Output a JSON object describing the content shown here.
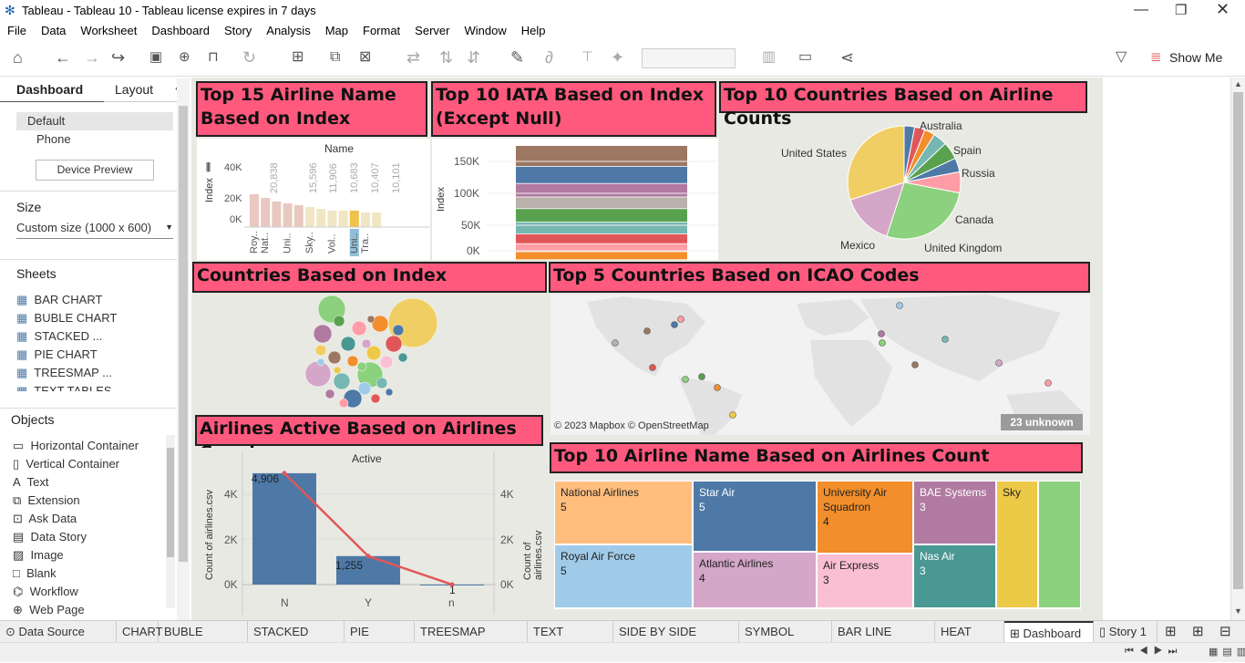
{
  "window": {
    "title": "Tableau - Tableau 10 - Tableau license expires in 7 days"
  },
  "menu": [
    "File",
    "Data",
    "Worksheet",
    "Dashboard",
    "Story",
    "Analysis",
    "Map",
    "Format",
    "Server",
    "Window",
    "Help"
  ],
  "toolbar": {
    "show_me": "Show Me"
  },
  "left": {
    "tab_dashboard": "Dashboard",
    "tab_layout": "Layout",
    "device_default": "Default",
    "device_phone": "Phone",
    "device_preview": "Device Preview",
    "size_label": "Size",
    "size_value": "Custom size (1000 x 600)",
    "sheets_label": "Sheets",
    "sheets": [
      "BAR CHART",
      "BUBLE CHART",
      "STACKED ...",
      "PIE CHART",
      "TREESMAP ...",
      "TEXT TABLES"
    ],
    "objects_label": "Objects",
    "objects": [
      "Horizontal Container",
      "Vertical Container",
      "Text",
      "Extension",
      "Ask Data",
      "Data Story",
      "Image",
      "Blank",
      "Workflow",
      "Web Page"
    ]
  },
  "dashboard": {
    "h1": "Top 15 Airline Name Based on Index",
    "h2": "Top 10 IATA Based on Index (Except Null)",
    "h3": "Top 10 Countries Based on Airline Counts",
    "h4": "Countries Based on Index",
    "h5": "Top 5 Countries Based on ICAO Codes",
    "h6": "Airlines Active Based on Airlines Count",
    "h7": "Top 10 Airline Name Based on Airlines Count",
    "map_credit": "© 2023 Mapbox © OpenStreetMap",
    "map_unknown": "23 unknown"
  },
  "chart_data": [
    {
      "type": "bar",
      "title": "Name",
      "ylabel": "Index",
      "yticks": [
        "40K",
        "20K",
        "0K"
      ],
      "categories": [
        "Roy..",
        "Nat..",
        "",
        "Uni..",
        "",
        "Sky..",
        "",
        "Vol..",
        "",
        "Uni..",
        "Tra.."
      ],
      "value_labels": [
        "20,838",
        "15,596",
        "11,906",
        "10,683",
        "10,407",
        "10,101"
      ]
    },
    {
      "type": "bar",
      "stacked": true,
      "ylabel": "Index",
      "yticks": [
        "150K",
        "100K",
        "50K",
        "0K"
      ],
      "segment_colors": [
        "#9c7761",
        "#4e79a7",
        "#b07aa1",
        "#bab0ac",
        "#59a14f",
        "#76b7b2",
        "#e15759",
        "#ff9da7",
        "#f28e2b",
        "#edc948"
      ]
    },
    {
      "type": "pie",
      "labels": [
        "United States",
        "Australia",
        "Spain",
        "Russia",
        "Canada",
        "United Kingdom",
        "Mexico"
      ]
    },
    {
      "type": "bar",
      "title": "Active",
      "ylabel": "Count of airlines.csv",
      "yticks": [
        "4K",
        "2K",
        "0K"
      ],
      "categories": [
        "N",
        "Y",
        "n"
      ],
      "values": [
        4906,
        1255,
        1
      ],
      "value_labels": [
        "4,906",
        "1,255",
        "1"
      ],
      "color": "#4e79a7",
      "line_color": "#e15759"
    },
    {
      "type": "treemap",
      "cells": [
        {
          "name": "National Airlines",
          "value": "5",
          "color": "#ffbe7d"
        },
        {
          "name": "Star Air",
          "value": "5",
          "color": "#4e79a7"
        },
        {
          "name": "University Air Squadron",
          "value": "4",
          "color": "#f28e2b"
        },
        {
          "name": "BAE Systems",
          "value": "3",
          "color": "#b07aa1"
        },
        {
          "name": "Sky",
          "value": "",
          "color": "#edc948"
        },
        {
          "name": "",
          "value": "",
          "color": "#8cd17d"
        },
        {
          "name": "Royal Air Force",
          "value": "5",
          "color": "#a0cbe8"
        },
        {
          "name": "Atlantic Airlines",
          "value": "4",
          "color": "#d4a6c8"
        },
        {
          "name": "Air Express",
          "value": "3",
          "color": "#fabfd2"
        },
        {
          "name": "Nas Air",
          "value": "3",
          "color": "#499894"
        }
      ]
    }
  ],
  "bottom_tabs": [
    "Data Source",
    "CHART",
    "BUBLE CHART",
    "STACKED BARS",
    "PIE CHART",
    "TREESMAP CHART",
    "TEXT TABLES",
    "SIDE BY SIDE CIRCLE",
    "SYMBOL MAPS",
    "BAR LINE CHART",
    "HEAT MAP",
    "Dashboard",
    "Story 1"
  ]
}
